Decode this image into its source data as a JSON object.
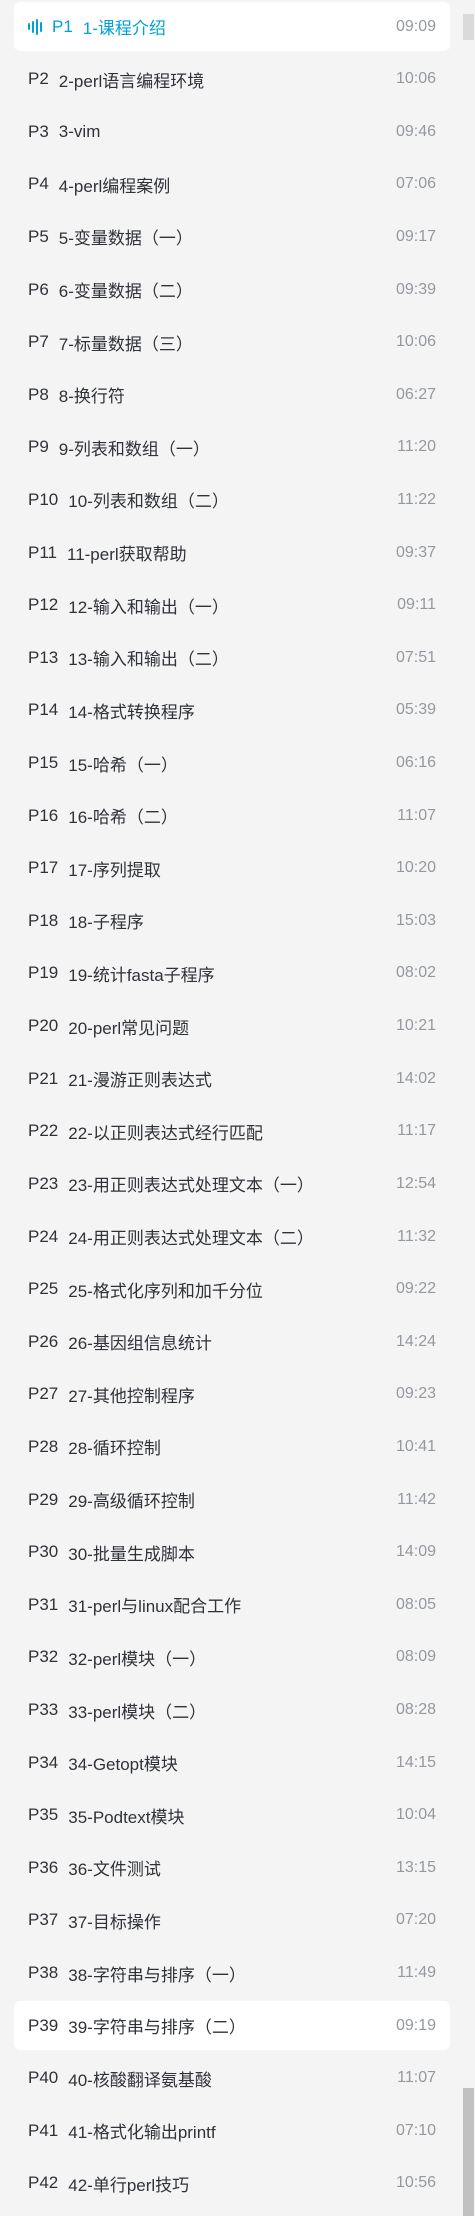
{
  "episodes": [
    {
      "num": "P1",
      "title": "1-课程介绍",
      "duration": "09:09"
    },
    {
      "num": "P2",
      "title": "2-perl语言编程环境",
      "duration": "10:06"
    },
    {
      "num": "P3",
      "title": "3-vim",
      "duration": "09:46"
    },
    {
      "num": "P4",
      "title": "4-perl编程案例",
      "duration": "07:06"
    },
    {
      "num": "P5",
      "title": "5-变量数据（一）",
      "duration": "09:17"
    },
    {
      "num": "P6",
      "title": "6-变量数据（二）",
      "duration": "09:39"
    },
    {
      "num": "P7",
      "title": "7-标量数据（三）",
      "duration": "10:06"
    },
    {
      "num": "P8",
      "title": "8-换行符",
      "duration": "06:27"
    },
    {
      "num": "P9",
      "title": "9-列表和数组（一）",
      "duration": "11:20"
    },
    {
      "num": "P10",
      "title": "10-列表和数组（二）",
      "duration": "11:22"
    },
    {
      "num": "P11",
      "title": "11-perl获取帮助",
      "duration": "09:37"
    },
    {
      "num": "P12",
      "title": "12-输入和输出（一）",
      "duration": "09:11"
    },
    {
      "num": "P13",
      "title": "13-输入和输出（二）",
      "duration": "07:51"
    },
    {
      "num": "P14",
      "title": "14-格式转换程序",
      "duration": "05:39"
    },
    {
      "num": "P15",
      "title": "15-哈希（一）",
      "duration": "06:16"
    },
    {
      "num": "P16",
      "title": "16-哈希（二）",
      "duration": "11:07"
    },
    {
      "num": "P17",
      "title": "17-序列提取",
      "duration": "10:20"
    },
    {
      "num": "P18",
      "title": "18-子程序",
      "duration": "15:03"
    },
    {
      "num": "P19",
      "title": "19-统计fasta子程序",
      "duration": "08:02"
    },
    {
      "num": "P20",
      "title": "20-perl常见问题",
      "duration": "10:21"
    },
    {
      "num": "P21",
      "title": "21-漫游正则表达式",
      "duration": "14:02"
    },
    {
      "num": "P22",
      "title": "22-以正则表达式经行匹配",
      "duration": "11:17"
    },
    {
      "num": "P23",
      "title": "23-用正则表达式处理文本（一）",
      "duration": "12:54"
    },
    {
      "num": "P24",
      "title": "24-用正则表达式处理文本（二）",
      "duration": "11:32"
    },
    {
      "num": "P25",
      "title": "25-格式化序列和加千分位",
      "duration": "09:22"
    },
    {
      "num": "P26",
      "title": "26-基因组信息统计",
      "duration": "14:24"
    },
    {
      "num": "P27",
      "title": "27-其他控制程序",
      "duration": "09:23"
    },
    {
      "num": "P28",
      "title": "28-循环控制",
      "duration": "10:41"
    },
    {
      "num": "P29",
      "title": "29-高级循环控制",
      "duration": "11:42"
    },
    {
      "num": "P30",
      "title": "30-批量生成脚本",
      "duration": "14:09"
    },
    {
      "num": "P31",
      "title": "31-perl与linux配合工作",
      "duration": "08:05"
    },
    {
      "num": "P32",
      "title": "32-perl模块（一）",
      "duration": "08:09"
    },
    {
      "num": "P33",
      "title": "33-perl模块（二）",
      "duration": "08:28"
    },
    {
      "num": "P34",
      "title": "34-Getopt模块",
      "duration": "14:15"
    },
    {
      "num": "P35",
      "title": "35-Podtext模块",
      "duration": "10:04"
    },
    {
      "num": "P36",
      "title": "36-文件测试",
      "duration": "13:15"
    },
    {
      "num": "P37",
      "title": "37-目标操作",
      "duration": "07:20"
    },
    {
      "num": "P38",
      "title": "38-字符串与排序（一）",
      "duration": "11:49"
    },
    {
      "num": "P39",
      "title": "39-字符串与排序（二）",
      "duration": "09:19"
    },
    {
      "num": "P40",
      "title": "40-核酸翻译氨基酸",
      "duration": "11:07"
    },
    {
      "num": "P41",
      "title": "41-格式化输出printf",
      "duration": "07:10"
    },
    {
      "num": "P42",
      "title": "42-单行perl技巧",
      "duration": "10:56"
    }
  ],
  "active_episode": "P1",
  "hover_episode": "P39",
  "colors": {
    "accent": "#00a1d6",
    "text": "#2f3238",
    "duration": "#9499a0",
    "background": "#f4f4f4",
    "active_bg": "#ffffff"
  },
  "icons": {
    "playing": "playing-bars-icon"
  }
}
